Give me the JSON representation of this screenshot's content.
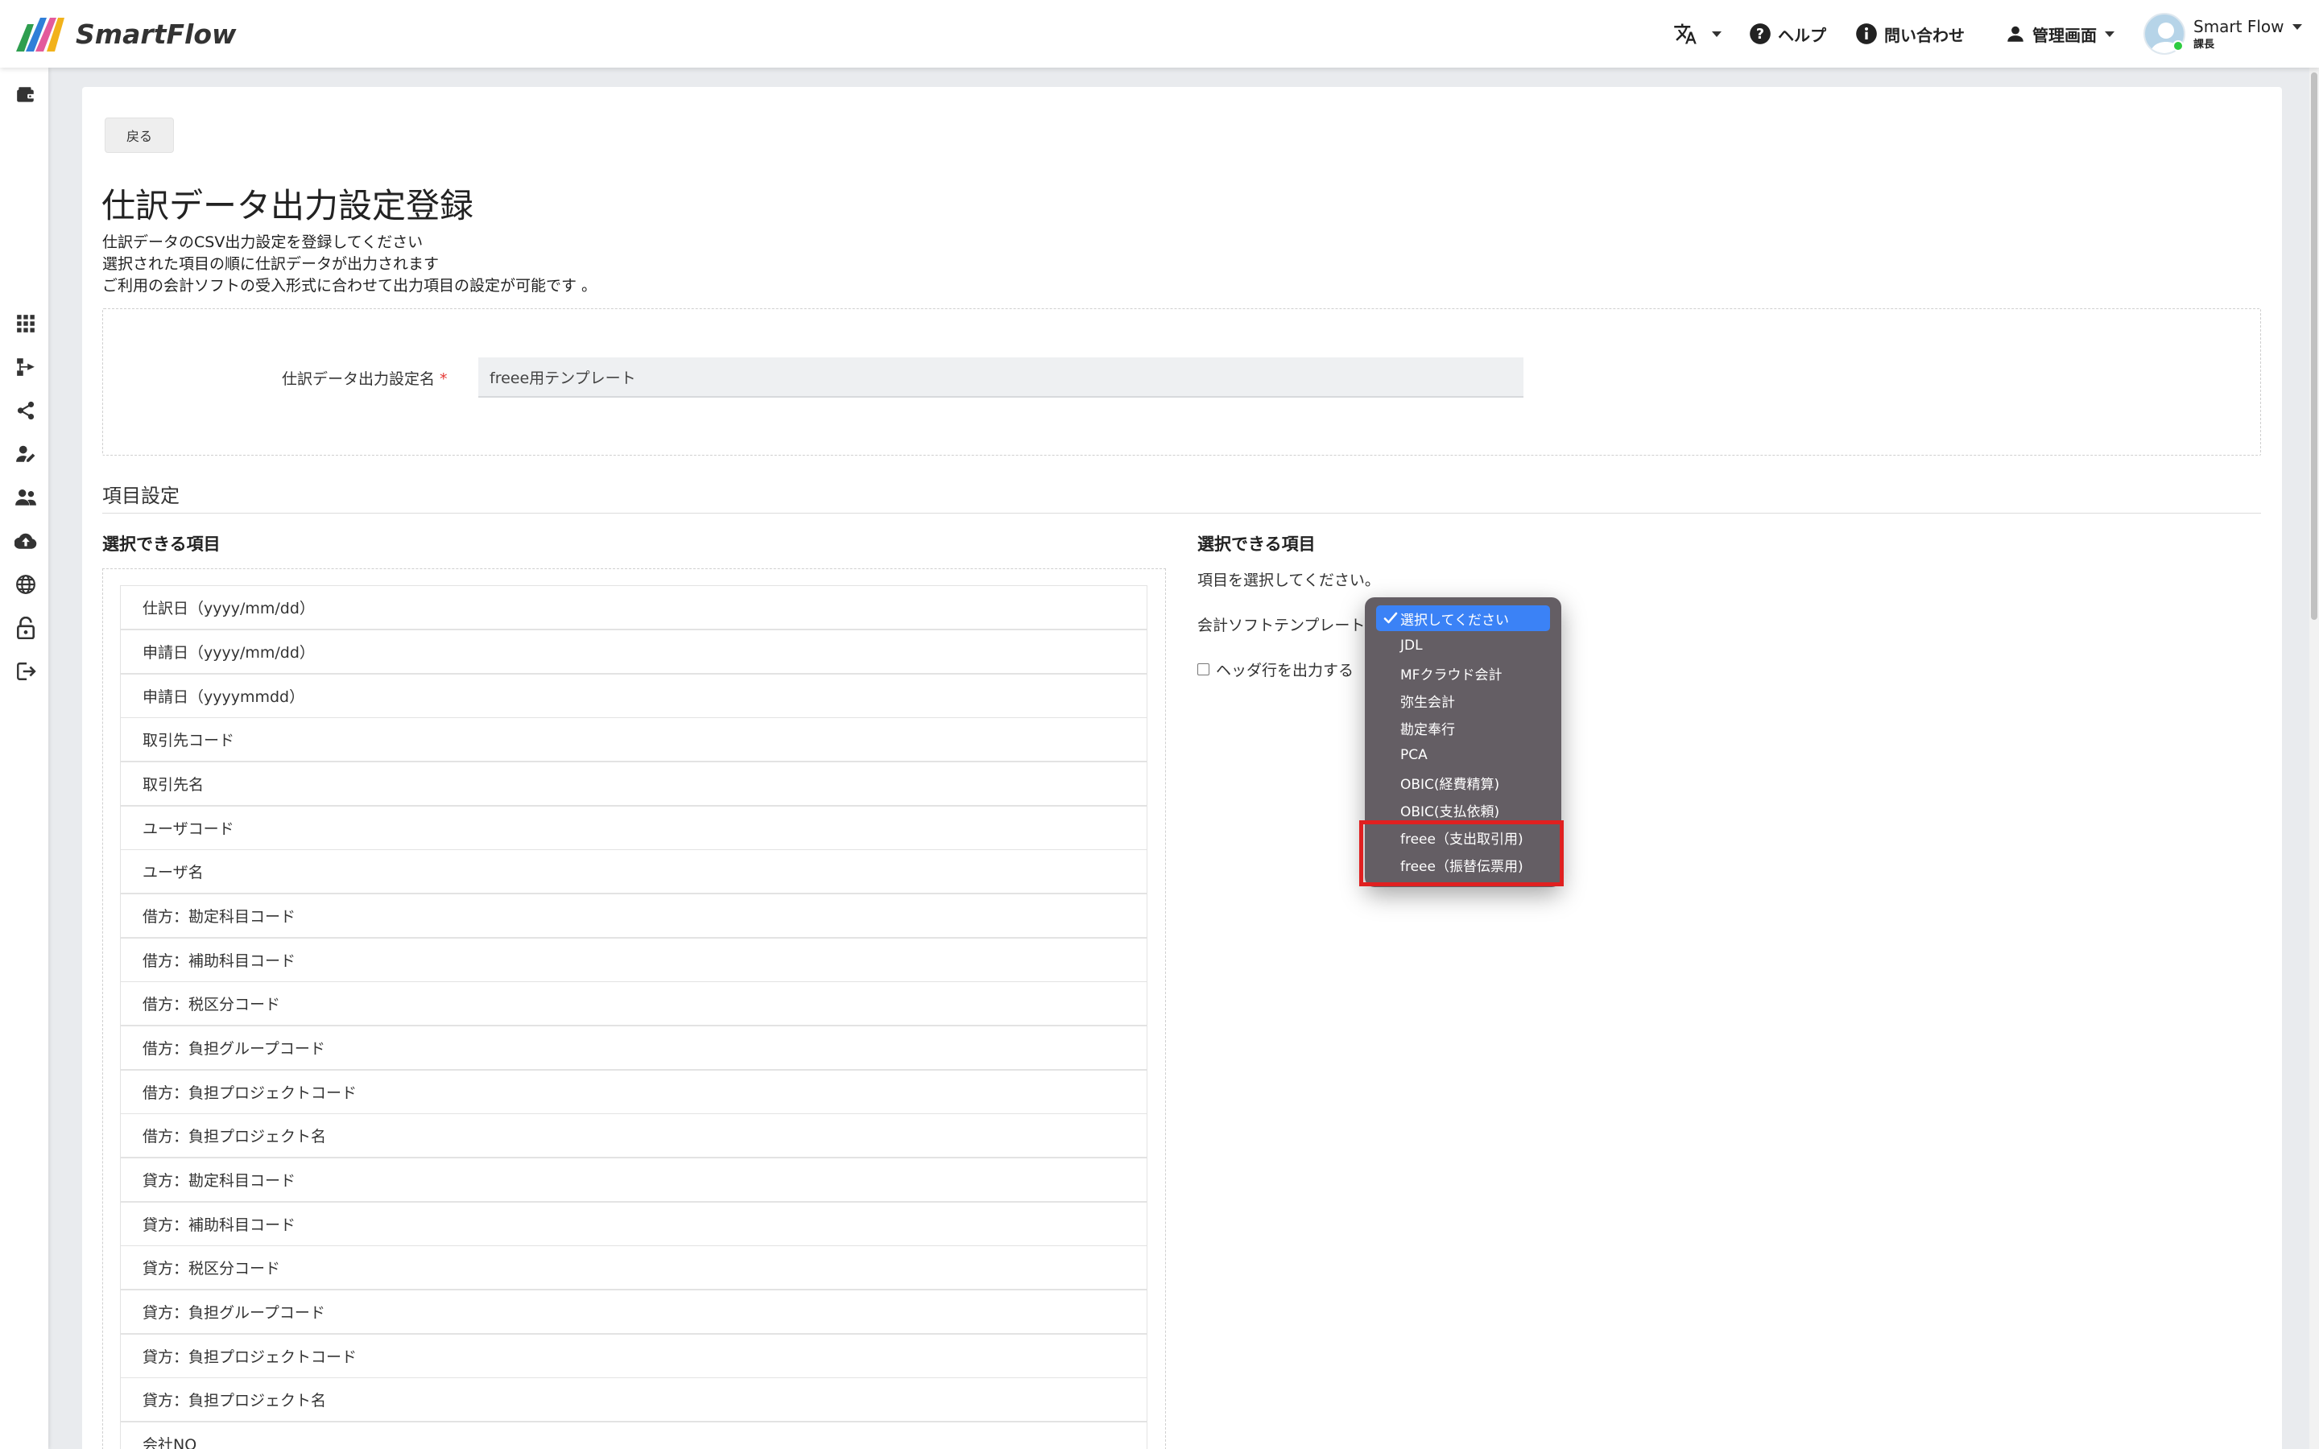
{
  "header": {
    "app_name": "SmartFlow",
    "translate_icon": "translate-icon",
    "help_label": "ヘルプ",
    "contact_label": "問い合わせ",
    "admin_label": "管理画面",
    "user_name": "Smart Flow",
    "user_role": "課長"
  },
  "sidebar": {
    "icons": [
      "wallet-icon",
      "apps-grid-icon",
      "workflow-icon",
      "share-icon",
      "user-edit-icon",
      "users-icon",
      "cloud-upload-icon",
      "globe-icon",
      "lock-icon",
      "export-icon"
    ]
  },
  "page": {
    "back_label": "戻る",
    "title": "仕訳データ出力設定登録",
    "description": [
      "仕訳データのCSV出力設定を登録してください",
      "選択された項目の順に仕訳データが出力されます",
      "ご利用の会計ソフトの受入形式に合わせて出力項目の設定が可能です 。"
    ],
    "name_label": "仕訳データ出力設定名",
    "required_mark": "*",
    "name_value": "freee用テンプレート",
    "section_title": "項目設定",
    "left_col_title": "選択できる項目",
    "right_col_title": "選択できる項目",
    "hint": "項目を選択してください。",
    "template_label": "会計ソフトテンプレート",
    "header_row_label": "ヘッダ行を出力する"
  },
  "items": [
    "仕訳日（yyyy/mm/dd）",
    "申請日（yyyy/mm/dd）",
    "申請日（yyyymmdd）",
    "取引先コード",
    "取引先名",
    "ユーザコード",
    "ユーザ名",
    "借方：勘定科目コード",
    "借方：補助科目コード",
    "借方：税区分コード",
    "借方：負担グループコード",
    "借方：負担プロジェクトコード",
    "借方：負担プロジェクト名",
    "貸方：勘定科目コード",
    "貸方：補助科目コード",
    "貸方：税区分コード",
    "貸方：負担グループコード",
    "貸方：負担プロジェクトコード",
    "貸方：負担プロジェクト名",
    "会社NO"
  ],
  "dropdown": {
    "options": [
      "選択してください",
      "JDL",
      "MFクラウド会計",
      "弥生会計",
      "勘定奉行",
      "PCA",
      "OBIC(経費精算)",
      "OBIC(支払依頼)",
      "freee（支出取引用)",
      "freee（振替伝票用)"
    ],
    "selected": "選択してください"
  },
  "colors": {
    "highlight": "#e02020",
    "selected_option": "#3b82f6",
    "required": "#e53935"
  }
}
